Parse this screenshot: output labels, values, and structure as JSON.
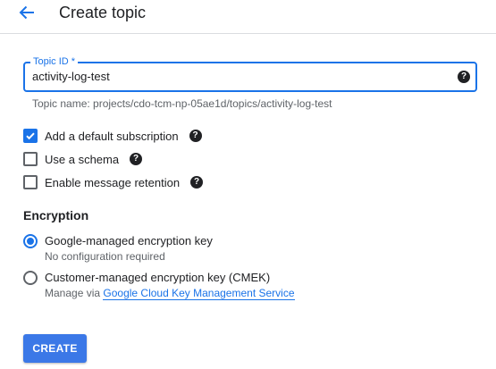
{
  "header": {
    "back_icon": "arrow-back-icon",
    "title": "Create topic"
  },
  "colors": {
    "accent": "#1a73e8",
    "button": "#3b78e7",
    "secondary_text": "#5f6368"
  },
  "topic_id": {
    "label": "Topic ID *",
    "value": "activity-log-test",
    "help_icon": "help-icon",
    "hint": "Topic name: projects/cdo-tcm-np-05ae1d/topics/activity-log-test"
  },
  "options": [
    {
      "label": "Add a default subscription",
      "checked": true
    },
    {
      "label": "Use a schema",
      "checked": false
    },
    {
      "label": "Enable message retention",
      "checked": false
    }
  ],
  "encryption": {
    "title": "Encryption",
    "google_managed": {
      "label": "Google-managed encryption key",
      "sub": "No configuration required",
      "selected": true
    },
    "customer_managed": {
      "label": "Customer-managed encryption key (CMEK)",
      "sub_prefix": "Manage via",
      "sub_link": "Google Cloud Key Management Service",
      "selected": false
    }
  },
  "actions": {
    "create_label": "CREATE"
  }
}
